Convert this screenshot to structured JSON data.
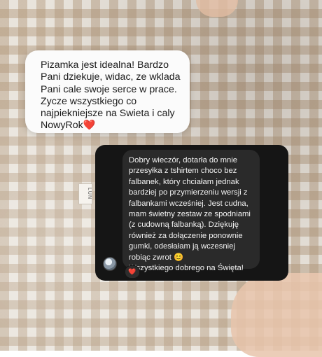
{
  "messages": {
    "received": {
      "text": "Pizamka jest idealna! Bardzo\nPani dziekuje, widac, ze wklada\nPani cale swoje serce w prace.\nZycze wszystkiego co\nnajpiekniejsze na Swieta i caly\nNowyRok❤️"
    },
    "sent": {
      "text": "Dobry wieczór, dotarła do mnie\nprzesyłka z tshirtem choco bez\nfalbanek, który chciałam jednak\nbardziej po przymierzeniu wersji z\nfalbankami wcześniej. Jest cudna,\nmam świetny zestaw ze spodniami\n(z cudowną falbanką). Dziękuję\nrównież za dołączenie ponownie\ngumki, odesłałam ją wczesniej\nrobiąc zwrot 😊\nWszystkiego dobrego na Święta!",
      "reaction": "❤️"
    }
  },
  "garment_label": "LUN",
  "colors": {
    "light_bubble": "#fbfbfb",
    "dark_panel": "#151515",
    "dark_bubble": "#2a2a2a"
  }
}
